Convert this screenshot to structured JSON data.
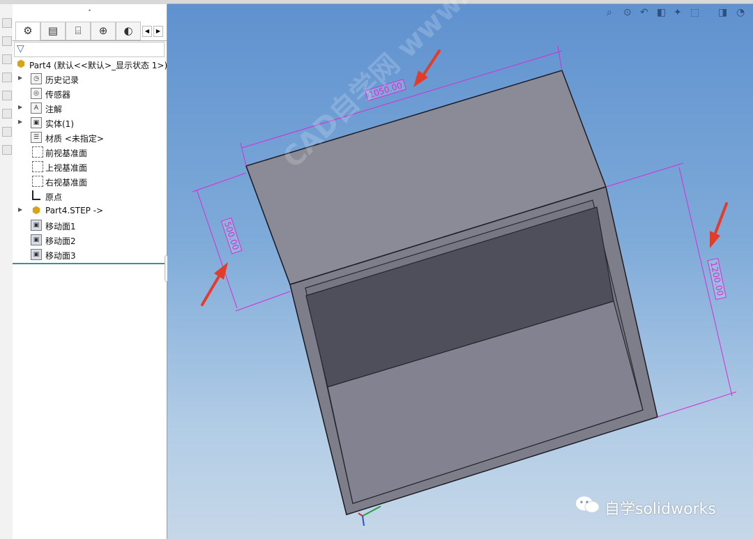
{
  "panel": {
    "tabs": [
      {
        "name": "feature-manager-tab",
        "glyph": "⚙"
      },
      {
        "name": "property-manager-tab",
        "glyph": "▤"
      },
      {
        "name": "configuration-manager-tab",
        "glyph": "⌸"
      },
      {
        "name": "dimxpert-tab",
        "glyph": "⊕"
      },
      {
        "name": "display-manager-tab",
        "glyph": "◐"
      }
    ],
    "tree": {
      "root": "Part4  (默认<<默认>_显示状态 1>)",
      "items": [
        {
          "label": "历史记录",
          "expandable": true,
          "icon": "history-icon"
        },
        {
          "label": "传感器",
          "expandable": false,
          "icon": "sensor-icon"
        },
        {
          "label": "注解",
          "expandable": true,
          "icon": "annotation-icon"
        },
        {
          "label": "实体(1)",
          "expandable": true,
          "icon": "solid-bodies-icon"
        },
        {
          "label": "材质 <未指定>",
          "expandable": false,
          "icon": "material-icon"
        },
        {
          "label": "前视基准面",
          "expandable": false,
          "icon": "plane-icon"
        },
        {
          "label": "上视基准面",
          "expandable": false,
          "icon": "plane-icon"
        },
        {
          "label": "右视基准面",
          "expandable": false,
          "icon": "plane-icon"
        },
        {
          "label": "原点",
          "expandable": false,
          "icon": "origin-icon"
        },
        {
          "label": "Part4.STEP ->",
          "expandable": true,
          "icon": "imported-part-icon"
        },
        {
          "label": "移动面1",
          "expandable": false,
          "icon": "move-face-icon"
        },
        {
          "label": "移动面2",
          "expandable": false,
          "icon": "move-face-icon"
        },
        {
          "label": "移动面3",
          "expandable": false,
          "icon": "move-face-icon"
        }
      ]
    }
  },
  "viewport": {
    "dimensions": {
      "top": "1050.00",
      "left": "500.00",
      "right": "1200.00"
    },
    "watermark": "CAD自学网  www.cadzxw.com",
    "colors": {
      "dimension": "#d62bd6",
      "arrow": "#e23c2a",
      "face_top": "#8b8b98",
      "face_front": "#7f7f8d"
    }
  },
  "branding": {
    "wechat_text": "自学solidworks"
  }
}
